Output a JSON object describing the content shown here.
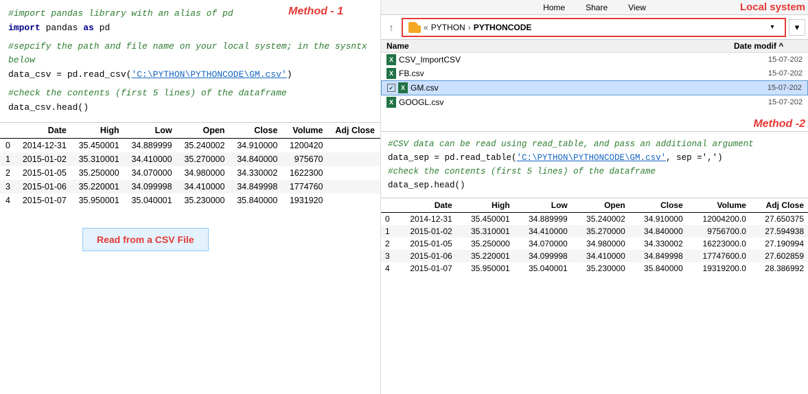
{
  "method1": {
    "label": "Method - 1"
  },
  "method2": {
    "label": "Method -2"
  },
  "local_system": {
    "label": "Local system"
  },
  "code_left": {
    "line1_comment": "#import pandas library with an alias of pd",
    "line2": "import pandas as pd",
    "line3_comment": "#sepcify the path and file name on your local system; in the sysntx below",
    "line4_before": "data_csv = pd.read_csv(",
    "line4_string": "'C:\\PYTHON\\PYTHONCODE\\GM.csv'",
    "line4_after": ")",
    "line5_comment": "#check the contents (first 5 lines) of the dataframe",
    "line6": "data_csv.head()"
  },
  "code_right": {
    "line1_comment": "#CSV data can be read using read_table, and pass an additional argument",
    "line2_before": "data_sep = pd.read_table(",
    "line2_string": "'C:\\PYTHON\\PYTHONCODE\\GM.csv'",
    "line2_after": ", sep =',')",
    "line3_comment": "#check the contents (first 5 lines) of the dataframe",
    "line4": "data_sep.head()"
  },
  "file_explorer": {
    "top_strip": [
      "Home",
      "Share",
      "View"
    ],
    "nav_up_arrow": "↑",
    "path_folder": "PYTHON",
    "path_sep1": "›",
    "path_name": "PYTHONCODE",
    "col_name": "Name",
    "col_date": "Date modif",
    "files": [
      {
        "name": "CSV_ImportCSV",
        "date": "15-07-202"
      },
      {
        "name": "FB.csv",
        "date": "15-07-202"
      },
      {
        "name": "GM.csv",
        "date": "15-07-202",
        "selected": true
      },
      {
        "name": "GOOGL.csv",
        "date": "15-07-202"
      }
    ]
  },
  "table_left": {
    "headers": [
      "",
      "Date",
      "High",
      "Low",
      "Open",
      "Close",
      "Volume",
      "Adj Close"
    ],
    "rows": [
      [
        "0",
        "2014-12-31",
        "35.450001",
        "34.889999",
        "35.240002",
        "34.910000",
        "1200420",
        ""
      ],
      [
        "1",
        "2015-01-02",
        "35.310001",
        "34.410000",
        "35.270000",
        "34.840000",
        "975670",
        ""
      ],
      [
        "2",
        "2015-01-05",
        "35.250000",
        "34.070000",
        "34.980000",
        "34.330002",
        "1622300",
        ""
      ],
      [
        "3",
        "2015-01-06",
        "35.220001",
        "34.099998",
        "34.410000",
        "34.849998",
        "1774760",
        ""
      ],
      [
        "4",
        "2015-01-07",
        "35.950001",
        "35.040001",
        "35.230000",
        "35.840000",
        "1931920",
        ""
      ]
    ]
  },
  "table_right": {
    "headers": [
      "",
      "Date",
      "High",
      "Low",
      "Open",
      "Close",
      "Volume",
      "Adj Close"
    ],
    "rows": [
      [
        "0",
        "2014-12-31",
        "35.450001",
        "34.889999",
        "35.240002",
        "34.910000",
        "12004200.0",
        "27.650375"
      ],
      [
        "1",
        "2015-01-02",
        "35.310001",
        "34.410000",
        "35.270000",
        "34.840000",
        "9756700.0",
        "27.594938"
      ],
      [
        "2",
        "2015-01-05",
        "35.250000",
        "34.070000",
        "34.980000",
        "34.330002",
        "16223000.0",
        "27.190994"
      ],
      [
        "3",
        "2015-01-06",
        "35.220001",
        "34.099998",
        "34.410000",
        "34.849998",
        "17747600.0",
        "27.602859"
      ],
      [
        "4",
        "2015-01-07",
        "35.950001",
        "35.040001",
        "35.230000",
        "35.840000",
        "19319200.0",
        "28.386992"
      ]
    ]
  },
  "read_csv_btn": {
    "label": "Read from a CSV File"
  }
}
